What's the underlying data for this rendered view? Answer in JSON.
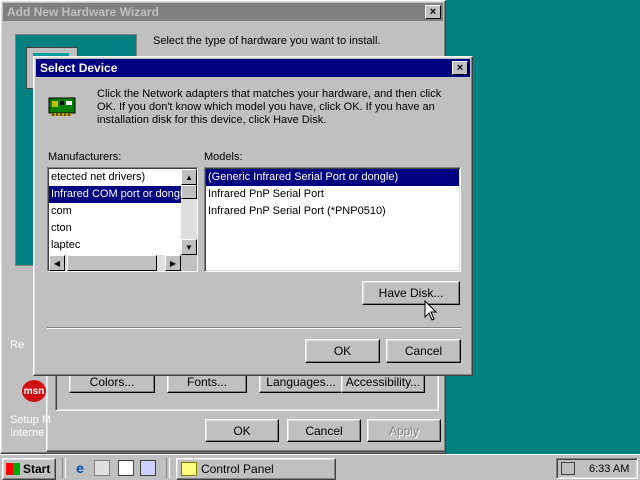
{
  "wizard": {
    "title": "Add New Hardware Wizard",
    "instruction": "Select the type of hardware you want to install.",
    "buttons": {
      "colors": "Colors...",
      "fonts": "Fonts...",
      "languages": "Languages...",
      "accessibility": "Accessibility..."
    },
    "ok": "OK",
    "cancel": "Cancel",
    "apply": "Apply"
  },
  "desktop": {
    "partial_text_1": "Re",
    "partial_text_2": "Setup M",
    "partial_text_3": "Interne",
    "msn_logo": "msn"
  },
  "dialog": {
    "title": "Select Device",
    "close_label": "×",
    "icon": "network-adapter-icon",
    "description": "Click the Network adapters that matches your hardware, and then click OK. If you don't know which model you have, click OK. If you have an installation disk for this device, click Have Disk.",
    "manufacturers_label": "Manufacturers:",
    "models_label": "Models:",
    "manufacturers": [
      {
        "label": "etected net drivers)",
        "selected": false
      },
      {
        "label": "Infrared COM port or dongle)",
        "selected": true
      },
      {
        "label": "com",
        "selected": false
      },
      {
        "label": "cton",
        "selected": false
      },
      {
        "label": "laptec",
        "selected": false
      }
    ],
    "models": [
      {
        "label": "(Generic Infrared Serial Port or dongle)",
        "selected": true
      },
      {
        "label": "Infrared PnP Serial Port",
        "selected": false
      },
      {
        "label": "Infrared PnP Serial Port (*PNP0510)",
        "selected": false
      }
    ],
    "have_disk": "Have Disk...",
    "ok": "OK",
    "cancel": "Cancel"
  },
  "taskbar": {
    "start": "Start",
    "tasks": [
      {
        "label": "Control Panel"
      }
    ],
    "clock": "6:33 AM",
    "colors": {
      "title_active": "#000080",
      "title_inactive": "#808080",
      "selection": "#000080"
    }
  }
}
